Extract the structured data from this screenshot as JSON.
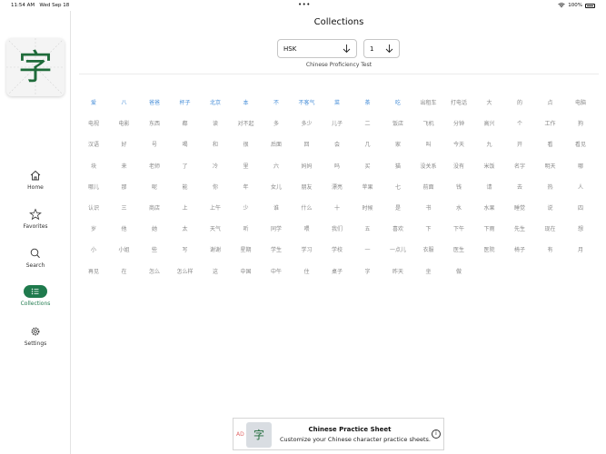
{
  "status_bar": {
    "time": "11:54 AM",
    "date": "Wed Sep 18",
    "battery": "100%"
  },
  "app": {
    "logo_char": "字"
  },
  "sidebar": {
    "items": [
      {
        "label": "Home",
        "icon": "home-icon"
      },
      {
        "label": "Favorites",
        "icon": "star-icon"
      },
      {
        "label": "Search",
        "icon": "search-icon"
      },
      {
        "label": "Collections",
        "icon": "list-icon",
        "active": true
      },
      {
        "label": "Settings",
        "icon": "gear-icon"
      }
    ]
  },
  "main": {
    "title": "Collections",
    "collection_select": {
      "value": "HSK"
    },
    "level_select": {
      "value": "1"
    },
    "subtitle": "Chinese Proficiency Test",
    "highlight_color": "#4a90d9",
    "rows": [
      [
        {
          "t": "爱",
          "h": true
        },
        {
          "t": "八",
          "h": true
        },
        {
          "t": "爸爸",
          "h": true
        },
        {
          "t": "杯子",
          "h": true
        },
        {
          "t": "北京",
          "h": true
        },
        {
          "t": "本",
          "h": true
        },
        {
          "t": "不",
          "h": true
        },
        {
          "t": "不客气",
          "h": true
        },
        {
          "t": "菜",
          "h": true
        },
        {
          "t": "茶",
          "h": true
        },
        {
          "t": "吃",
          "h": true
        },
        {
          "t": "出租车"
        },
        {
          "t": "打电话"
        },
        {
          "t": "大"
        },
        {
          "t": "的"
        },
        {
          "t": "点"
        },
        {
          "t": "电脑"
        }
      ],
      [
        {
          "t": "电视"
        },
        {
          "t": "电影"
        },
        {
          "t": "东西"
        },
        {
          "t": "都"
        },
        {
          "t": "读"
        },
        {
          "t": "对不起"
        },
        {
          "t": "多"
        },
        {
          "t": "多少"
        },
        {
          "t": "儿子"
        },
        {
          "t": "二"
        },
        {
          "t": "饭店"
        },
        {
          "t": "飞机"
        },
        {
          "t": "分钟"
        },
        {
          "t": "高兴"
        },
        {
          "t": "个"
        },
        {
          "t": "工作"
        },
        {
          "t": "狗"
        }
      ],
      [
        {
          "t": "汉语"
        },
        {
          "t": "好"
        },
        {
          "t": "号"
        },
        {
          "t": "喝"
        },
        {
          "t": "和"
        },
        {
          "t": "很"
        },
        {
          "t": "后面"
        },
        {
          "t": "回"
        },
        {
          "t": "会"
        },
        {
          "t": "几"
        },
        {
          "t": "家"
        },
        {
          "t": "叫"
        },
        {
          "t": "今天"
        },
        {
          "t": "九"
        },
        {
          "t": "开"
        },
        {
          "t": "看"
        },
        {
          "t": "看见"
        }
      ],
      [
        {
          "t": "块"
        },
        {
          "t": "来"
        },
        {
          "t": "老师"
        },
        {
          "t": "了"
        },
        {
          "t": "冷"
        },
        {
          "t": "里"
        },
        {
          "t": "六"
        },
        {
          "t": "妈妈"
        },
        {
          "t": "吗"
        },
        {
          "t": "买"
        },
        {
          "t": "猫"
        },
        {
          "t": "没关系"
        },
        {
          "t": "没有"
        },
        {
          "t": "米饭"
        },
        {
          "t": "名字"
        },
        {
          "t": "明天"
        },
        {
          "t": "哪"
        }
      ],
      [
        {
          "t": "哪儿"
        },
        {
          "t": "那"
        },
        {
          "t": "呢"
        },
        {
          "t": "能"
        },
        {
          "t": "你"
        },
        {
          "t": "年"
        },
        {
          "t": "女儿"
        },
        {
          "t": "朋友"
        },
        {
          "t": "漂亮"
        },
        {
          "t": "苹果"
        },
        {
          "t": "七"
        },
        {
          "t": "前面"
        },
        {
          "t": "钱"
        },
        {
          "t": "请"
        },
        {
          "t": "去"
        },
        {
          "t": "热"
        },
        {
          "t": "人"
        }
      ],
      [
        {
          "t": "认识"
        },
        {
          "t": "三"
        },
        {
          "t": "商店"
        },
        {
          "t": "上"
        },
        {
          "t": "上午"
        },
        {
          "t": "少"
        },
        {
          "t": "谁"
        },
        {
          "t": "什么"
        },
        {
          "t": "十"
        },
        {
          "t": "时候"
        },
        {
          "t": "是"
        },
        {
          "t": "书"
        },
        {
          "t": "水"
        },
        {
          "t": "水果"
        },
        {
          "t": "睡觉"
        },
        {
          "t": "说"
        },
        {
          "t": "四"
        }
      ],
      [
        {
          "t": "岁"
        },
        {
          "t": "他"
        },
        {
          "t": "她"
        },
        {
          "t": "太"
        },
        {
          "t": "天气"
        },
        {
          "t": "听"
        },
        {
          "t": "同学"
        },
        {
          "t": "喂"
        },
        {
          "t": "我们"
        },
        {
          "t": "五"
        },
        {
          "t": "喜欢"
        },
        {
          "t": "下"
        },
        {
          "t": "下午"
        },
        {
          "t": "下雨"
        },
        {
          "t": "先生"
        },
        {
          "t": "现在"
        },
        {
          "t": "想"
        }
      ],
      [
        {
          "t": "小"
        },
        {
          "t": "小姐"
        },
        {
          "t": "些"
        },
        {
          "t": "写"
        },
        {
          "t": "谢谢"
        },
        {
          "t": "星期"
        },
        {
          "t": "学生"
        },
        {
          "t": "学习"
        },
        {
          "t": "学校"
        },
        {
          "t": "一"
        },
        {
          "t": "一点儿"
        },
        {
          "t": "衣服"
        },
        {
          "t": "医生"
        },
        {
          "t": "医院"
        },
        {
          "t": "椅子"
        },
        {
          "t": "有"
        },
        {
          "t": "月"
        }
      ],
      [
        {
          "t": "再见"
        },
        {
          "t": "在"
        },
        {
          "t": "怎么"
        },
        {
          "t": "怎么样"
        },
        {
          "t": "这"
        },
        {
          "t": "中国"
        },
        {
          "t": "中午"
        },
        {
          "t": "住"
        },
        {
          "t": "桌子"
        },
        {
          "t": "字"
        },
        {
          "t": "昨天"
        },
        {
          "t": "坐"
        },
        {
          "t": "做"
        }
      ]
    ]
  },
  "ad": {
    "tag": "AD",
    "icon_char": "字",
    "title": "Chinese Practice Sheet",
    "text": "Customize your Chinese character practice sheets.",
    "info": "i"
  }
}
